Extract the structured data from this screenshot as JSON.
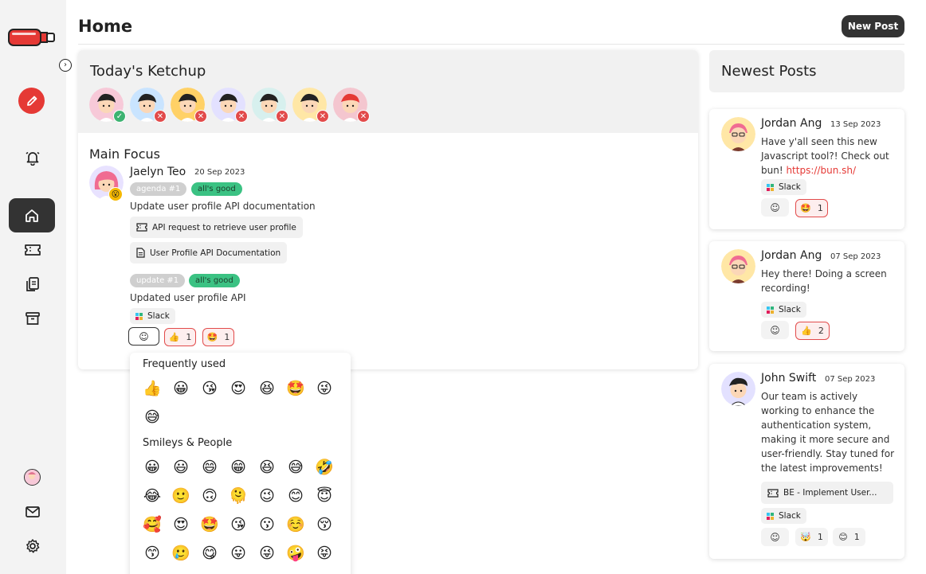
{
  "header": {
    "title": "Home",
    "new_post_label": "New Post"
  },
  "sidebar": {
    "items": [
      {
        "name": "notifications",
        "icon": "bell-icon"
      },
      {
        "name": "home",
        "icon": "home-icon",
        "active": true
      },
      {
        "name": "tickets",
        "icon": "ticket-icon"
      },
      {
        "name": "documents",
        "icon": "documents-icon"
      },
      {
        "name": "archive",
        "icon": "archive-icon"
      }
    ],
    "bottom": [
      {
        "name": "profile",
        "icon": "avatar"
      },
      {
        "name": "mail",
        "icon": "mail-icon"
      },
      {
        "name": "settings",
        "icon": "gear-icon"
      }
    ]
  },
  "ketchup": {
    "title": "Today's Ketchup",
    "members": [
      {
        "status": "done",
        "color": "#f7c9d8"
      },
      {
        "status": "missing",
        "color": "#c9e4ff"
      },
      {
        "status": "missing",
        "color": "#ffd166"
      },
      {
        "status": "missing",
        "color": "#e3e1ff"
      },
      {
        "status": "missing",
        "color": "#d7f0ee"
      },
      {
        "status": "missing",
        "color": "#ffe7a6"
      },
      {
        "status": "missing",
        "color": "#f4c6cf"
      }
    ],
    "focus_label": "Main Focus",
    "post": {
      "author": "Jaelyn Teo",
      "date": "20 Sep 2023",
      "agenda_tag": "agenda #1",
      "agenda_status": "all's good",
      "agenda_text": "Update user profile API documentation",
      "attachments": [
        {
          "icon": "ticket-icon",
          "label": "API request to retrieve user profile"
        },
        {
          "icon": "document-icon",
          "label": "User Profile API Documentation"
        }
      ],
      "update_tag": "update #1",
      "update_status": "all's good",
      "update_text": "Updated user profile API",
      "source": "Slack",
      "reactions": [
        {
          "emoji": "👍",
          "count": "1"
        },
        {
          "emoji": "🤩",
          "count": "1"
        }
      ]
    }
  },
  "picker": {
    "frequent_label": "Frequently used",
    "frequent": [
      "👍",
      "😀",
      "😘",
      "😍",
      "😆",
      "🤩",
      "😜",
      "😅"
    ],
    "smileys_label": "Smileys & People",
    "smileys": [
      "😀",
      "😃",
      "😄",
      "😁",
      "😆",
      "😅",
      "🤣",
      "😂",
      "🙂",
      "🙃",
      "🫠",
      "😉",
      "😊",
      "😇",
      "🥰",
      "😍",
      "🤩",
      "😘",
      "😗",
      "☺️",
      "😚",
      "😙",
      "🥲",
      "😋",
      "😛",
      "😜",
      "🤪",
      "😝"
    ]
  },
  "newest": {
    "title": "Newest Posts",
    "posts": [
      {
        "author": "Jordan Ang",
        "date": "13 Sep 2023",
        "text_before": "Have y'all seen this new Javascript tool?! Check out bun! ",
        "link": "https://bun.sh/",
        "source": "Slack",
        "reactions": [
          {
            "emoji": "🤩",
            "count": "1",
            "active": true
          }
        ]
      },
      {
        "author": "Jordan Ang",
        "date": "07 Sep 2023",
        "text": "Hey there! Doing a screen recording!",
        "source": "Slack",
        "reactions": [
          {
            "emoji": "👍",
            "count": "2",
            "active": true
          }
        ]
      },
      {
        "author": "John Swift",
        "date": "07 Sep 2023",
        "text": "Our team is actively working to enhance the authentication system, making it more secure and user-friendly. Stay tuned for the latest improvements!",
        "ticket": "BE - Implement User...",
        "source": "Slack",
        "reactions": [
          {
            "emoji": "🤯",
            "count": "1",
            "active": false
          },
          {
            "emoji": "😊",
            "count": "1",
            "active": false
          }
        ]
      }
    ]
  }
}
